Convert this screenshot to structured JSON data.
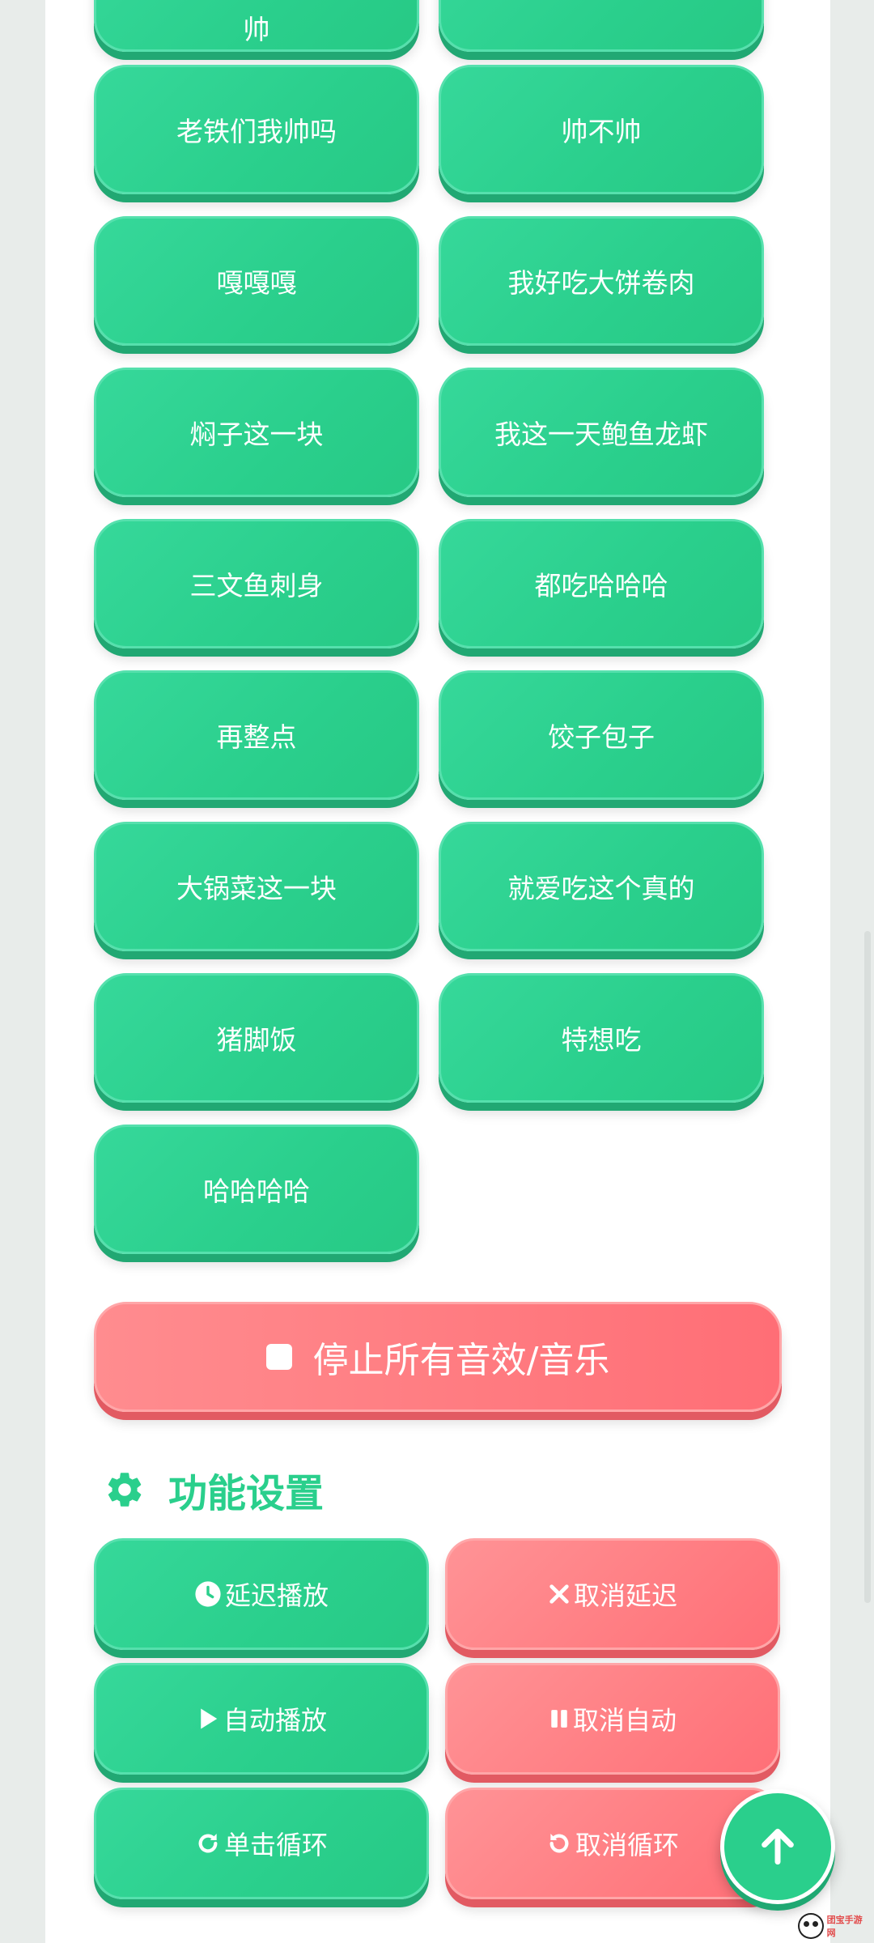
{
  "sound_buttons": [
    {
      "label": "帅"
    },
    {
      "label": ""
    },
    {
      "label": "老铁们我帅吗"
    },
    {
      "label": "帅不帅"
    },
    {
      "label": "嘎嘎嘎"
    },
    {
      "label": "我好吃大饼卷肉"
    },
    {
      "label": "焖子这一块"
    },
    {
      "label": "我这一天鲍鱼龙虾"
    },
    {
      "label": "三文鱼刺身"
    },
    {
      "label": "都吃哈哈哈"
    },
    {
      "label": "再整点"
    },
    {
      "label": "饺子包子"
    },
    {
      "label": "大锅菜这一块"
    },
    {
      "label": "就爱吃这个真的"
    },
    {
      "label": "猪脚饭"
    },
    {
      "label": "特想吃"
    },
    {
      "label": "哈哈哈哈"
    }
  ],
  "stop_button": {
    "label": "停止所有音效/音乐",
    "icon": "stop-square-icon"
  },
  "settings": {
    "title": "功能设置",
    "icon": "gear-icon",
    "buttons": [
      {
        "label": "延迟播放",
        "icon": "clock-icon",
        "color": "green"
      },
      {
        "label": "取消延迟",
        "icon": "close-icon",
        "color": "red"
      },
      {
        "label": "自动播放",
        "icon": "play-icon",
        "color": "green"
      },
      {
        "label": "取消自动",
        "icon": "pause-icon",
        "color": "red"
      },
      {
        "label": "单击循环",
        "icon": "redo-icon",
        "color": "green"
      },
      {
        "label": "取消循环",
        "icon": "undo-icon",
        "color": "red"
      }
    ]
  },
  "fab": {
    "icon": "arrow-up-icon"
  },
  "watermark": {
    "text": "团宝手游网"
  },
  "colors": {
    "green": "#2acf8c",
    "red": "#ff7d82",
    "background": "#e8ecea"
  }
}
